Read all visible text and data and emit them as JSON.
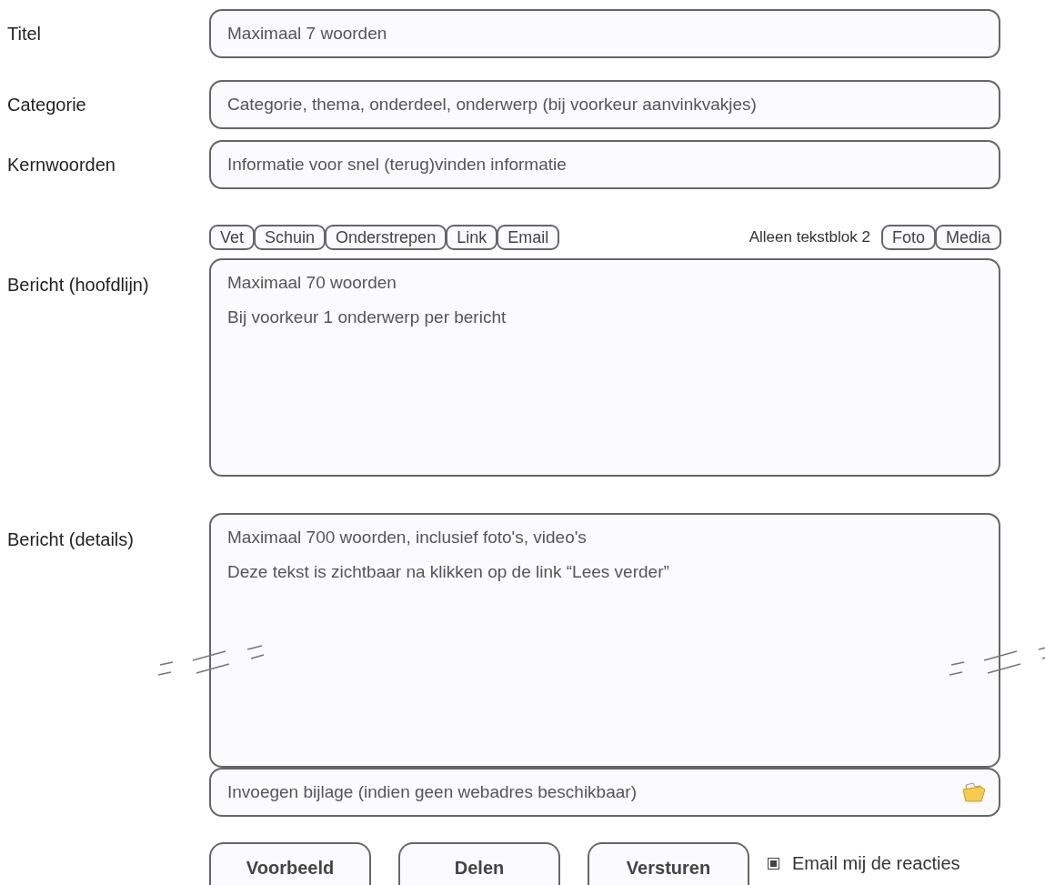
{
  "fields": [
    {
      "label": "Titel",
      "placeholder": "Maximaal 7 woorden"
    },
    {
      "label": "Categorie",
      "placeholder": "Categorie, thema, onderdeel, onderwerp (bij voorkeur aanvinkvakjes)"
    },
    {
      "label": "Kernwoorden",
      "placeholder": "Informatie voor snel (terug)vinden informatie"
    }
  ],
  "toolbar": {
    "format_buttons": [
      "Vet",
      "Schuin",
      "Onderstrepen",
      "Link",
      "Email"
    ],
    "note": "Alleen tekstblok 2",
    "media_buttons": [
      "Foto",
      "Media"
    ]
  },
  "summary": {
    "label": "Bericht (hoofdlijn)",
    "lines": [
      "Maximaal 70 woorden",
      "Bij voorkeur 1 onderwerp per bericht"
    ]
  },
  "details": {
    "label": "Bericht (details)",
    "lines": [
      "Maximaal 700 woorden, inclusief foto's, video's",
      "Deze tekst is zichtbaar na klikken op de link “Lees verder”"
    ],
    "truncated": true
  },
  "attachment": {
    "placeholder": "Invoegen bijlage (indien geen webadres beschikbaar)"
  },
  "actions": [
    "Voorbeeld",
    "Delen",
    "Versturen"
  ],
  "notify": {
    "label": "Email mij de reacties",
    "checked": true
  }
}
